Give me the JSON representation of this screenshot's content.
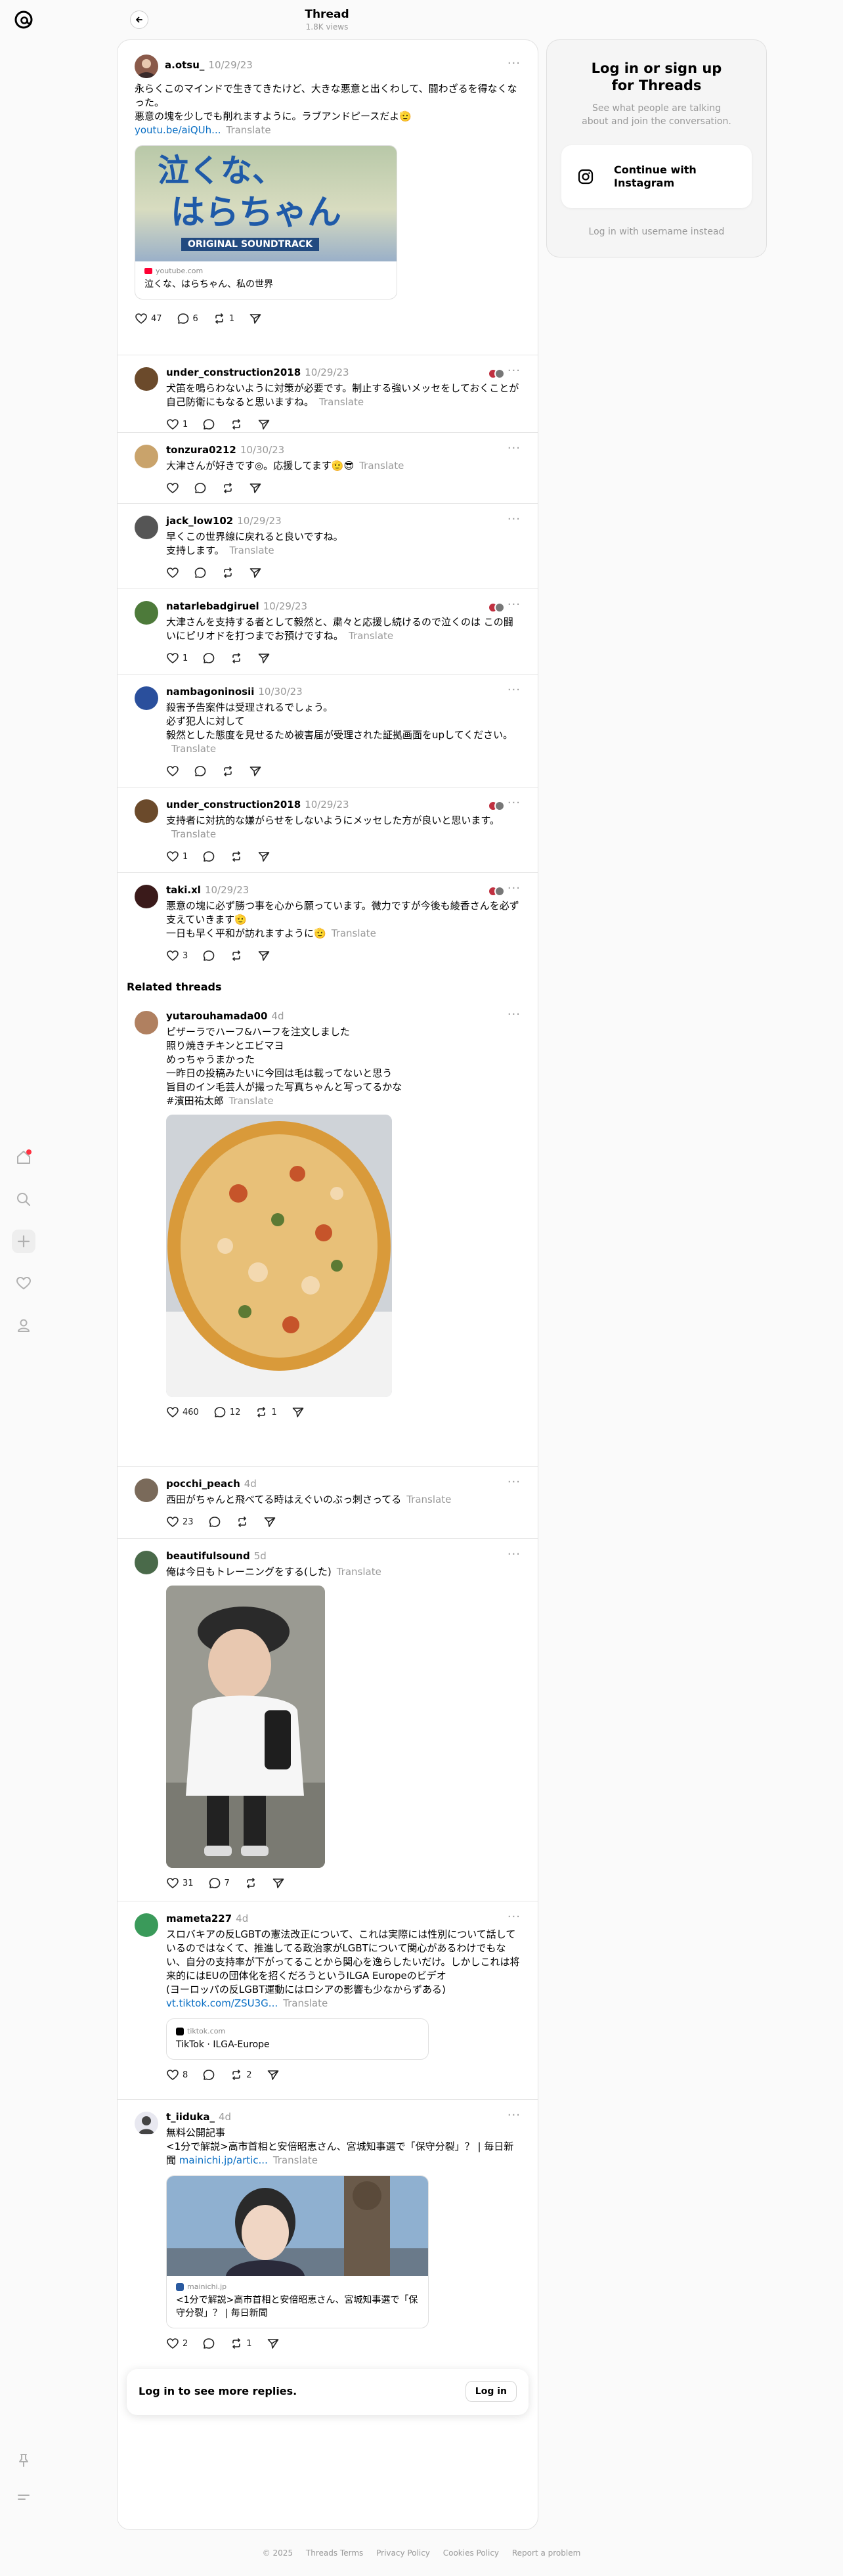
{
  "header": {
    "title": "Thread",
    "subtitle": "1.8K views"
  },
  "main_post": {
    "username": "a.otsu_",
    "time": "10/29/23",
    "text": "永らくこのマインドで生きてきたけど、大きな悪意と出くわして、闘わざるを得なくなった。\n悪意の塊を少しでも削れますように。ラブアンドピースだよ🫡",
    "link": "youtu.be/aiQUh...",
    "translate": "Translate",
    "card_source": "youtube.com",
    "card_title": "泣くな、はらちゃん、私の世界",
    "card_image_text_1": "泣くな、",
    "card_image_text_2": "はらちゃん",
    "card_image_text_3": "ORIGINAL SOUNDTRACK",
    "likes": "47",
    "replies": "6",
    "reposts": "1"
  },
  "replies": [
    {
      "username": "under_construction2018",
      "time": "10/29/23",
      "text": "犬笛を鳴らわないように対策が必要です。制止する強いメッセをしておくことが自己防衛にもなると思いますね。",
      "translate": "Translate",
      "likes": "1",
      "avatar_color": "#6b4a2b"
    },
    {
      "username": "tonzura0212",
      "time": "10/30/23",
      "text": "大津さんが好きです◎。応援してます🫡😎",
      "translate": "Translate",
      "likes": "",
      "avatar_color": "#c9a36b"
    },
    {
      "username": "jack_low102",
      "time": "10/29/23",
      "text": "早くこの世界線に戻れると良いですね。\n支持します。",
      "translate": "Translate",
      "likes": "",
      "avatar_color": "#555555"
    },
    {
      "username": "natarlebadgiruel",
      "time": "10/29/23",
      "text": "大津さんを支持する者として毅然と、粛々と応援し続けるので泣くのは この闘いにピリオドを打つまでお預けですね。",
      "translate": "Translate",
      "likes": "1",
      "avatar_color": "#4d7a3a"
    },
    {
      "username": "nambagoninosii",
      "time": "10/30/23",
      "text": "殺害予告案件は受理されるでしょう。\n必ず犯人に対して\n毅然とした態度を見せるため被害届が受理された証拠画面をupしてください。",
      "translate": "Translate",
      "likes": "",
      "avatar_color": "#2a4f9c"
    },
    {
      "username": "under_construction2018",
      "time": "10/29/23",
      "text": "支持者に対抗的な嫌がらせをしないようにメッセした方が良いと思います。",
      "translate": "Translate",
      "likes": "1",
      "avatar_color": "#6b4a2b"
    },
    {
      "username": "taki.xl",
      "time": "10/29/23",
      "text": "悪意の塊に必ず勝つ事を心から願っています。微力ですが今後も綾香さんを必ず支えていきます🫡\n一日も早く平和が訪れますように🫡",
      "translate": "Translate",
      "likes": "3",
      "avatar_color": "#3a1a1a"
    }
  ],
  "related": {
    "title": "Related threads",
    "posts": [
      {
        "username": "yutarouhamada00",
        "time": "4d",
        "text": "ピザーラでハーフ&ハーフを注文しました\n照り焼きチキンとエビマヨ\nめっちゃうまかった\n一昨日の投稿みたいに今回は毛は載ってないと思う\n旨目のイン毛芸人が撮った写真ちゃんと写ってるかな\n#濱田祐太郎",
        "translate": "Translate",
        "likes": "460",
        "replies": "12",
        "reposts": "1",
        "avatar_color": "#b08060"
      },
      {
        "username": "pocchi_peach",
        "time": "4d",
        "text": "西田がちゃんと飛べてる時はえぐいのぶっ刺さってる",
        "translate": "Translate",
        "likes": "23",
        "replies": "",
        "reposts": "",
        "avatar_color": "#7a6a5a"
      },
      {
        "username": "beautifulsound",
        "time": "5d",
        "text": "俺は今日もトレーニングをする(した)",
        "translate": "Translate",
        "likes": "31",
        "replies": "7",
        "reposts": "",
        "avatar_color": "#4a6a4a"
      },
      {
        "username": "mameta227",
        "time": "4d",
        "text": "スロバキアの反LGBTの憲法改正について、これは実際には性別について話しているのではなくて、推進してる政治家がLGBTについて関心があるわけでもない、自分の支持率が下がってることから関心を逸らしたいだけ。しかしこれは将来的にはEUの団体化を招くだろうというILGA Europeのビデオ\n(ヨーロッパの反LGBT運動にはロシアの影響も少なからずある)",
        "link": "vt.tiktok.com/ZSU3G...",
        "translate": "Translate",
        "card_source": "tiktok.com",
        "card_title": "TikTok · ILGA-Europe",
        "likes": "8",
        "replies": "",
        "reposts": "2",
        "avatar_color": "#3a9a5a"
      },
      {
        "username": "t_iiduka_",
        "time": "4d",
        "text": "無料公開記事\n<1分で解説>高市首相と安倍昭恵さん、宮城知事選で「保守分裂」？ | 毎日新聞",
        "link": "mainichi.jp/artic...",
        "translate": "Translate",
        "card_source": "mainichi.jp",
        "card_title": "<1分で解説>高市首相と安倍昭恵さん、宮城知事選で「保守分裂」？ | 毎日新聞",
        "likes": "2",
        "replies": "",
        "reposts": "1",
        "avatar_color": "#e8e8f0"
      }
    ]
  },
  "login_bar": {
    "text": "Log in to see more replies.",
    "button": "Log in"
  },
  "sidebar": {
    "title": "Log in or sign up for Threads",
    "subtitle": "See what people are talking about and join the conversation.",
    "instagram_button": "Continue with Instagram",
    "alt_login": "Log in with username instead"
  },
  "footer": {
    "copyright": "© 2025",
    "links": [
      "Threads Terms",
      "Privacy Policy",
      "Cookies Policy",
      "Report a problem"
    ]
  },
  "colors": {
    "link": "#0a6fc4",
    "muted": "#999999",
    "notification": "#ff3040"
  },
  "icons": [
    "threads-logo-icon",
    "home-icon",
    "search-icon",
    "plus-icon",
    "heart-icon",
    "profile-icon",
    "pin-icon",
    "menu-icon",
    "back-arrow-icon",
    "more-icon",
    "reply-icon",
    "repost-icon",
    "share-icon",
    "instagram-icon"
  ]
}
